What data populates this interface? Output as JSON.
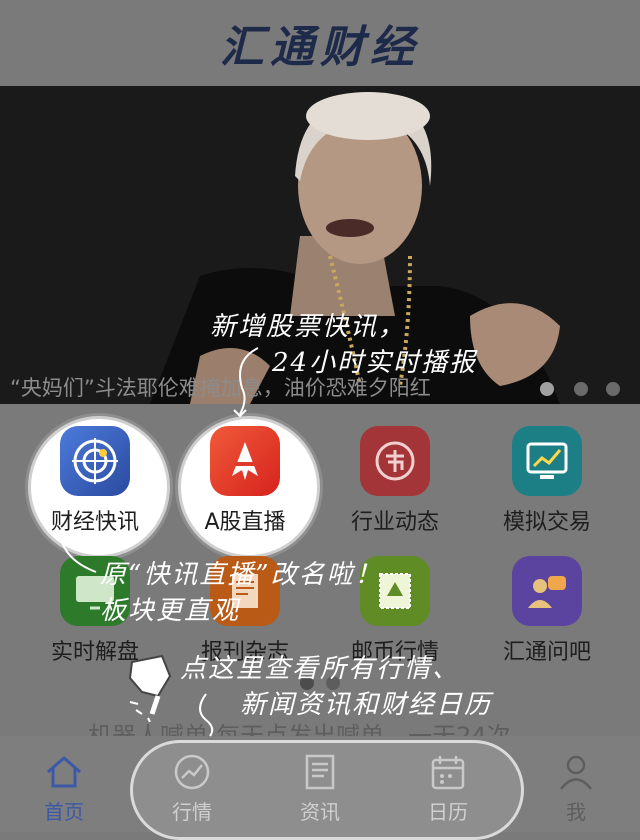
{
  "app": {
    "title": "汇通财经"
  },
  "banner": {
    "caption": "“央妈们”斗法耶伦难掩加息，油价恐难夕阳红",
    "slide_count": 3,
    "active_slide": 1
  },
  "grid": {
    "items": [
      {
        "label": "财经快讯",
        "icon": "radar-icon",
        "color": "#3f63c7"
      },
      {
        "label": "A股直播",
        "icon": "rocket-icon",
        "color": "#e0382a"
      },
      {
        "label": "行业动态",
        "icon": "market-icon",
        "color": "#c33a3f"
      },
      {
        "label": "模拟交易",
        "icon": "chart-icon",
        "color": "#1f8f95"
      },
      {
        "label": "实时解盘",
        "icon": "tv-icon",
        "color": "#2f8c2c"
      },
      {
        "label": "报刊杂志",
        "icon": "magazine-icon",
        "color": "#d66a1e"
      },
      {
        "label": "邮币行情",
        "icon": "stamp-icon",
        "color": "#6f9f2a"
      },
      {
        "label": "汇通问吧",
        "icon": "chat-icon",
        "color": "#6c52b5"
      }
    ],
    "pages": 2,
    "active_page": 1
  },
  "ticker": {
    "text": "机器人喊单:每天点发出喊单，一天24次"
  },
  "tabbar": {
    "items": [
      {
        "label": "首页",
        "icon": "home-icon"
      },
      {
        "label": "行情",
        "icon": "trend-icon"
      },
      {
        "label": "资讯",
        "icon": "news-icon"
      },
      {
        "label": "日历",
        "icon": "calendar-icon"
      },
      {
        "label": "我",
        "icon": "profile-icon"
      }
    ]
  },
  "guide": {
    "note1_line1": "新增股票快讯，",
    "note1_line2": "24小时实时播报",
    "note2_line1": "原“快讯直播”改名啦！",
    "note2_line2": "板块更直观",
    "note3_line1": "点这里查看所有行情、",
    "note3_line2": "新闻资讯和财经日历"
  }
}
